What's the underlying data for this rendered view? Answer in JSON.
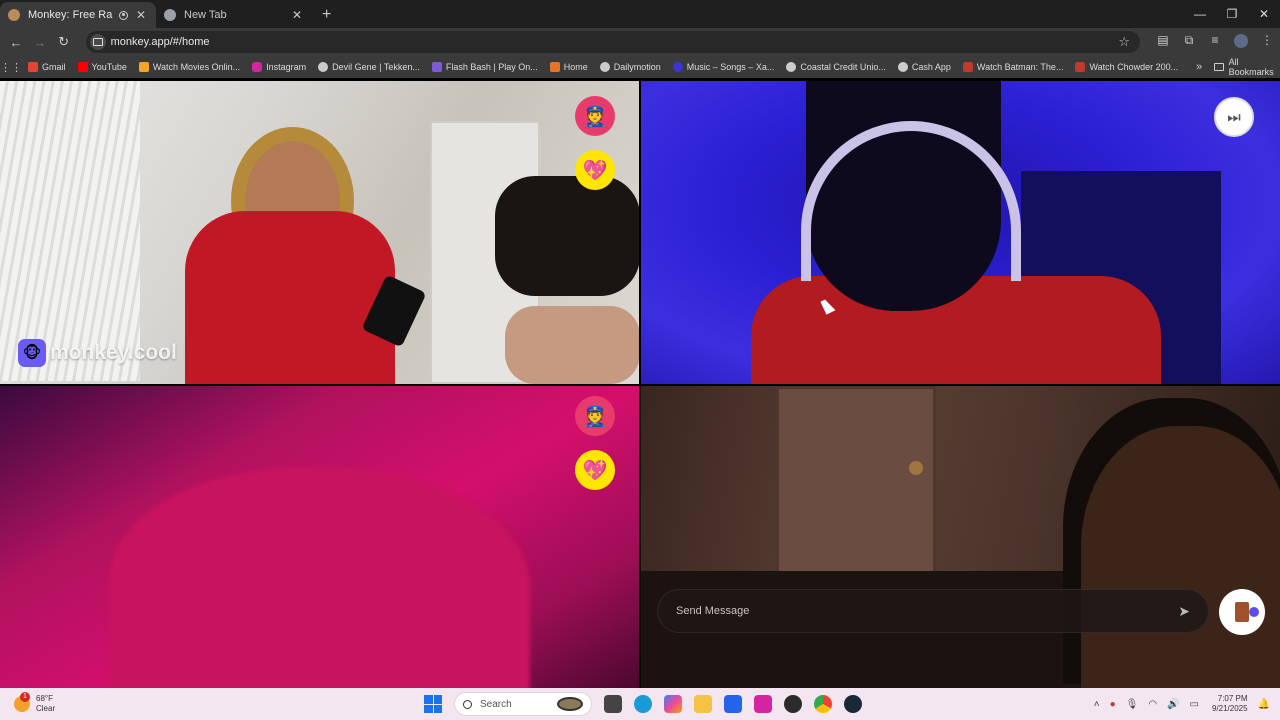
{
  "browser": {
    "tabs": [
      {
        "title": "Monkey: Free Random Vid",
        "active": true
      },
      {
        "title": "New Tab",
        "active": false
      }
    ],
    "new_tab_label": "+",
    "url": "monkey.app/#/home",
    "bookmarks": [
      {
        "label": "Gmail",
        "color": "#ea4335"
      },
      {
        "label": "YouTube",
        "color": "#ff0000"
      },
      {
        "label": "Watch Movies Onlin...",
        "color": "#f5a623"
      },
      {
        "label": "Instagram",
        "color": "#d6249f"
      },
      {
        "label": "Devil Gene | Tekken...",
        "color": "#cccccc"
      },
      {
        "label": "Flash Bash | Play On...",
        "color": "#7b5cd6"
      },
      {
        "label": "Home",
        "color": "#e8742b"
      },
      {
        "label": "Dailymotion",
        "color": "#cccccc"
      },
      {
        "label": "Music – Songs – Xa...",
        "color": "#3c34d8"
      },
      {
        "label": "Coastal Credit Unio...",
        "color": "#cccccc"
      },
      {
        "label": "Cash App",
        "color": "#cccccc"
      },
      {
        "label": "Watch Batman: The...",
        "color": "#c0392b"
      },
      {
        "label": "Watch Chowder 200...",
        "color": "#c0392b"
      }
    ],
    "all_bookmarks_label": "All Bookmarks"
  },
  "app": {
    "watermark": "monkey.cool",
    "chat_placeholder": "Send Message",
    "accent": "#6b5bf5",
    "report_color": "#e83b6c",
    "like_color": "#ffe600"
  },
  "taskbar": {
    "weather_temp": "68°F",
    "weather_desc": "Clear",
    "weather_alert_count": "1",
    "search_label": "Search",
    "time": "7:07 PM",
    "date": "9/21/2025"
  }
}
